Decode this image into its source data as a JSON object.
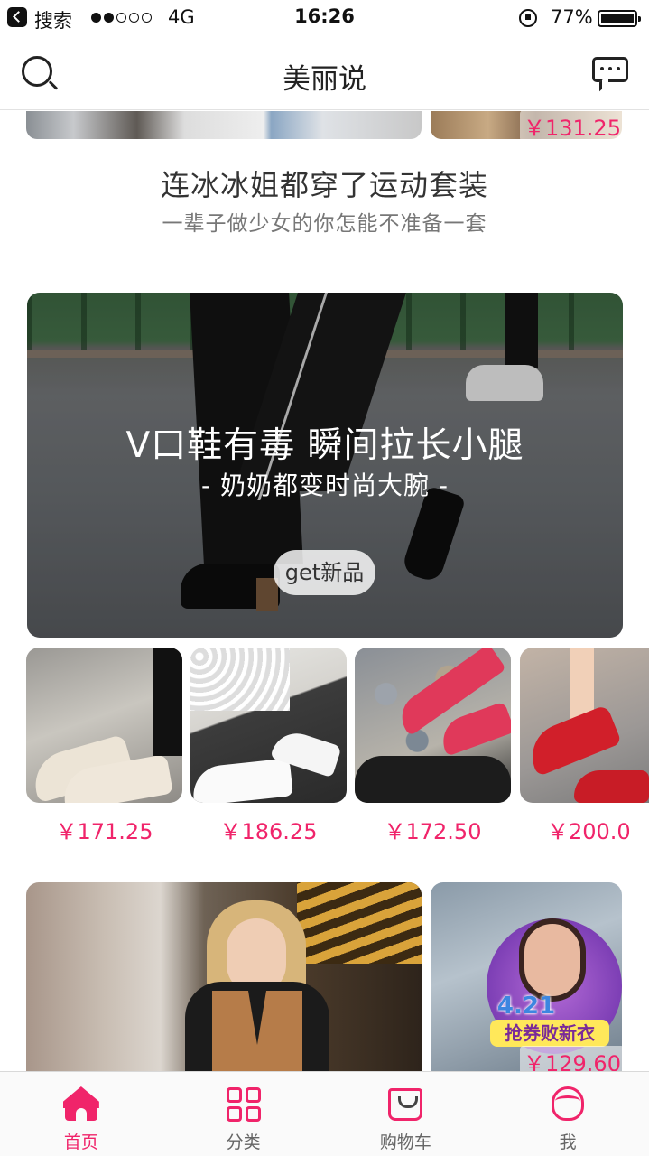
{
  "status_bar": {
    "back_label": "搜索",
    "signal_bars_on": 2,
    "signal_bars_total": 5,
    "network": "4G",
    "time": "16:26",
    "battery_pct": "77%"
  },
  "nav": {
    "title": "美丽说",
    "search_icon": "search-icon",
    "message_icon": "message-icon"
  },
  "top_strip": {
    "price": "￥131.25"
  },
  "promo": {
    "title": "连冰冰姐都穿了运动套装",
    "subtitle": "一辈子做少女的你怎能不准备一套"
  },
  "hero": {
    "title": "V口鞋有毒 瞬间拉长小腿",
    "subtitle": "- 奶奶都变时尚大腕 -",
    "button": "get新品"
  },
  "products": [
    {
      "price": "￥171.25"
    },
    {
      "price": "￥186.25"
    },
    {
      "price": "￥172.50"
    },
    {
      "price": "￥200.0"
    }
  ],
  "bottom_cards": {
    "badge_date": "4.21",
    "badge_slogan": "抢券败新衣",
    "price": "￥129.60"
  },
  "tabbar": {
    "active": "home",
    "tabs": [
      {
        "id": "home",
        "label": "首页",
        "icon": "home-icon"
      },
      {
        "id": "category",
        "label": "分类",
        "icon": "grid-icon"
      },
      {
        "id": "cart",
        "label": "购物车",
        "icon": "shopping-bag-icon"
      },
      {
        "id": "me",
        "label": "我",
        "icon": "profile-icon"
      }
    ]
  },
  "colors": {
    "accent": "#f0246a",
    "text_primary": "#333333",
    "text_secondary": "#777777"
  }
}
